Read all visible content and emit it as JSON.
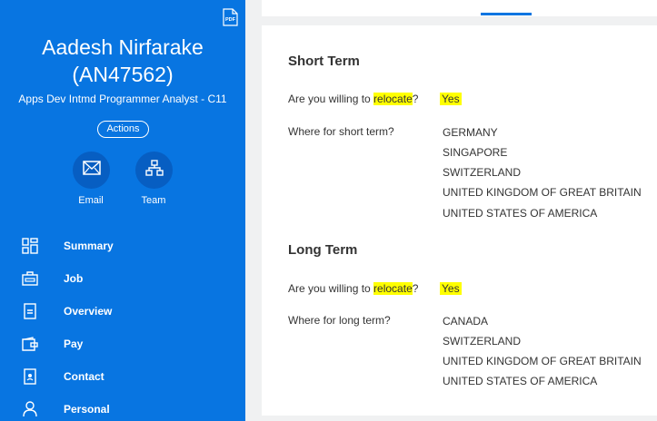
{
  "profile": {
    "name_line1": "Aadesh Nirfarake",
    "name_line2": "(AN47562)",
    "job_title": "Apps Dev Intmd Programmer Analyst - C11",
    "actions_label": "Actions",
    "pdf_icon_text": "PDF",
    "email_label": "Email",
    "team_label": "Team"
  },
  "nav": {
    "items": [
      {
        "label": "Summary",
        "icon": "summary-icon"
      },
      {
        "label": "Job",
        "icon": "briefcase-icon"
      },
      {
        "label": "Overview",
        "icon": "document-icon"
      },
      {
        "label": "Pay",
        "icon": "wallet-icon"
      },
      {
        "label": "Contact",
        "icon": "contact-card-icon"
      },
      {
        "label": "Personal",
        "icon": "person-icon"
      }
    ]
  },
  "short_term": {
    "title": "Short Term",
    "willing_prefix": "Are you willing to ",
    "willing_highlight": "relocate",
    "willing_suffix": "?",
    "willing_answer": "Yes",
    "where_label": "Where for short term?",
    "locations": [
      "GERMANY",
      "SINGAPORE",
      "SWITZERLAND",
      "UNITED KINGDOM OF GREAT BRITAIN",
      "UNITED STATES OF AMERICA"
    ]
  },
  "long_term": {
    "title": "Long Term",
    "willing_prefix": "Are you willing to ",
    "willing_highlight": "relocate",
    "willing_suffix": "?",
    "willing_answer": "Yes",
    "where_label": "Where for long term?",
    "locations": [
      "CANADA",
      "SWITZERLAND",
      "UNITED KINGDOM OF GREAT BRITAIN",
      "UNITED STATES OF AMERICA"
    ]
  },
  "colors": {
    "sidebar": "#0875e1",
    "highlight": "#ffff00",
    "circle_button": "#075ec2"
  }
}
